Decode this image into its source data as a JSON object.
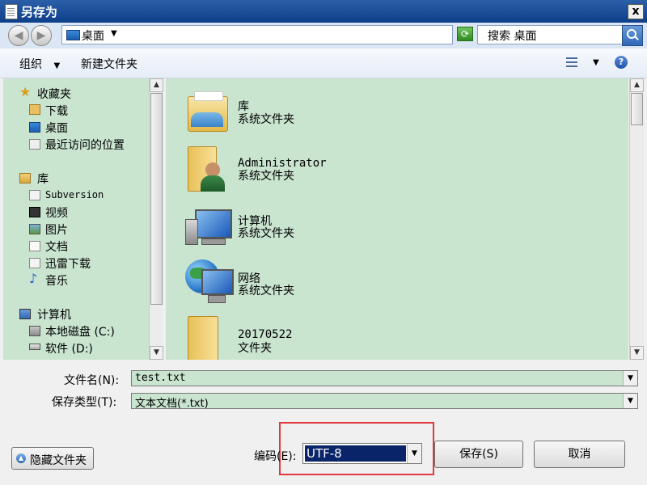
{
  "window": {
    "title": "另存为",
    "close": "x"
  },
  "nav": {
    "back": "◀",
    "forward": "▶",
    "address": "桌面",
    "search_placeholder": "搜索 桌面"
  },
  "toolbar": {
    "organize": "组织",
    "new_folder": "新建文件夹",
    "help": "?"
  },
  "sidebar": {
    "favorites_header": "收藏夹",
    "favorites": [
      "下载",
      "桌面",
      "最近访问的位置"
    ],
    "library_header": "库",
    "libraries": [
      "Subversion",
      "视频",
      "图片",
      "文档",
      "迅雷下载",
      "音乐"
    ],
    "computer_header": "计算机",
    "drives": [
      "本地磁盘 (C:)",
      "软件 (D:)"
    ]
  },
  "items": [
    {
      "name": "库",
      "type": "系统文件夹",
      "icon": "library-icon"
    },
    {
      "name": "Administrator",
      "type": "系统文件夹",
      "icon": "user-folder-icon"
    },
    {
      "name": "计算机",
      "type": "系统文件夹",
      "icon": "computer-icon"
    },
    {
      "name": "网络",
      "type": "系统文件夹",
      "icon": "network-icon"
    },
    {
      "name": "20170522",
      "type": "文件夹",
      "icon": "folder-icon"
    }
  ],
  "bottom": {
    "filename_label": "文件名(N):",
    "filename_value": "test.txt",
    "filetype_label": "保存类型(T):",
    "filetype_value": "文本文档(*.txt)",
    "hide_folders": "隐藏文件夹",
    "encoding_label": "编码(E):",
    "encoding_value": "UTF-8",
    "save": "保存(S)",
    "cancel": "取消"
  },
  "colors": {
    "highlight_box": "#e0393e",
    "content_bg": "#c9e4cf",
    "selection": "#0a246a"
  }
}
